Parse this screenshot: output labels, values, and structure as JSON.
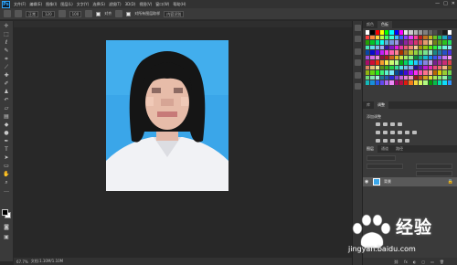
{
  "app": {
    "logo": "Ps"
  },
  "menubar": {
    "items": [
      "文件(F)",
      "编辑(E)",
      "图像(I)",
      "图层(L)",
      "文字(Y)",
      "选择(S)",
      "滤镜(T)",
      "3D(D)",
      "视图(V)",
      "窗口(W)",
      "帮助(H)"
    ]
  },
  "window_controls": {
    "minimize": "—",
    "maximize": "□",
    "close": "✕"
  },
  "options_bar": {
    "style_value": "正常",
    "size_value": "120",
    "flow_value": "100",
    "align_label": "对齐",
    "sample_all_label": "对所有图层取样",
    "content_aware_label": "内容识别"
  },
  "status_bar": {
    "zoom": "67.7%",
    "doc_info": "文档:1.10M/1.10M"
  },
  "panels": {
    "color_tabs": [
      "颜色",
      "色板"
    ],
    "adjustments_title": "添加调整",
    "adjustments_tabs": [
      "库",
      "调整"
    ],
    "layers_tabs": [
      "图层",
      "通道",
      "路径"
    ],
    "layer": {
      "name": "背景",
      "lock": "🔒"
    },
    "footer_icons": [
      "⛓",
      "fx",
      "◐",
      "▢",
      "▭",
      "🗑"
    ]
  },
  "swatch_colors": [
    "#ffffff",
    "#000000",
    "#ff0000",
    "#ffff00",
    "#00ff00",
    "#00ffff",
    "#0000ff",
    "#ff00ff",
    "#e6e6e6",
    "#cccccc",
    "#b3b3b3",
    "#999999",
    "#808080",
    "#666666",
    "#4d4d4d",
    "#333333",
    "#1a1a1a",
    "#ffffff",
    "#ff3d3d",
    "#ff8a3d",
    "#ffd83d",
    "#b8ff3d",
    "#3dff6b",
    "#3dffd2",
    "#3db8ff",
    "#3d5cff",
    "#8a3dff",
    "#e63dff",
    "#ff3d9a",
    "#c21e1e",
    "#c2711e",
    "#c2b51e",
    "#6fc21e",
    "#1ec25a",
    "#1ea9c2",
    "#1e4fc2"
  ],
  "watermark": {
    "brand": "经验",
    "url": "jingyan.baidu.com"
  },
  "tools": [
    "arrow-icon",
    "marquee-icon",
    "lasso-icon",
    "quick-select-icon",
    "crop-icon",
    "eyedropper-icon",
    "healing-icon",
    "brush-icon",
    "stamp-icon",
    "history-brush-icon",
    "eraser-icon",
    "gradient-icon",
    "blur-icon",
    "dodge-icon",
    "pen-icon",
    "type-icon",
    "path-select-icon",
    "shape-icon",
    "hand-icon",
    "zoom-icon",
    "more-icon"
  ]
}
